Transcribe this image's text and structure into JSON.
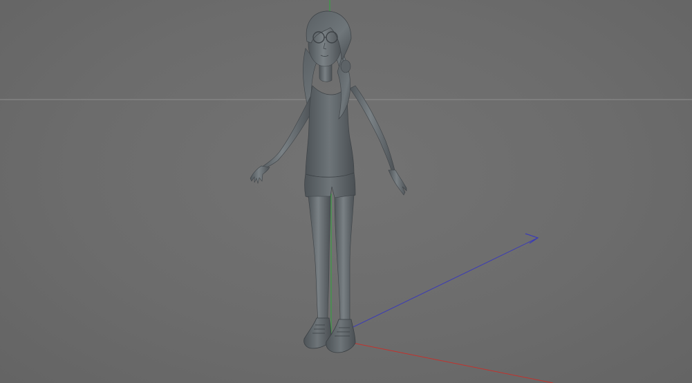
{
  "viewport": {
    "background_color": "#6b6b6b",
    "horizon_line_color": "#8c8c8c",
    "model_color": "#6a7074"
  },
  "axes": {
    "x_axis": {
      "color": "#c4312c",
      "icon": "x-axis-line"
    },
    "y_axis": {
      "color": "#2fa83a",
      "icon": "y-axis-line"
    },
    "z_axis": {
      "color": "#3a3ab8",
      "icon": "z-axis-arrow"
    }
  },
  "model": {
    "icon": "character-figure"
  }
}
